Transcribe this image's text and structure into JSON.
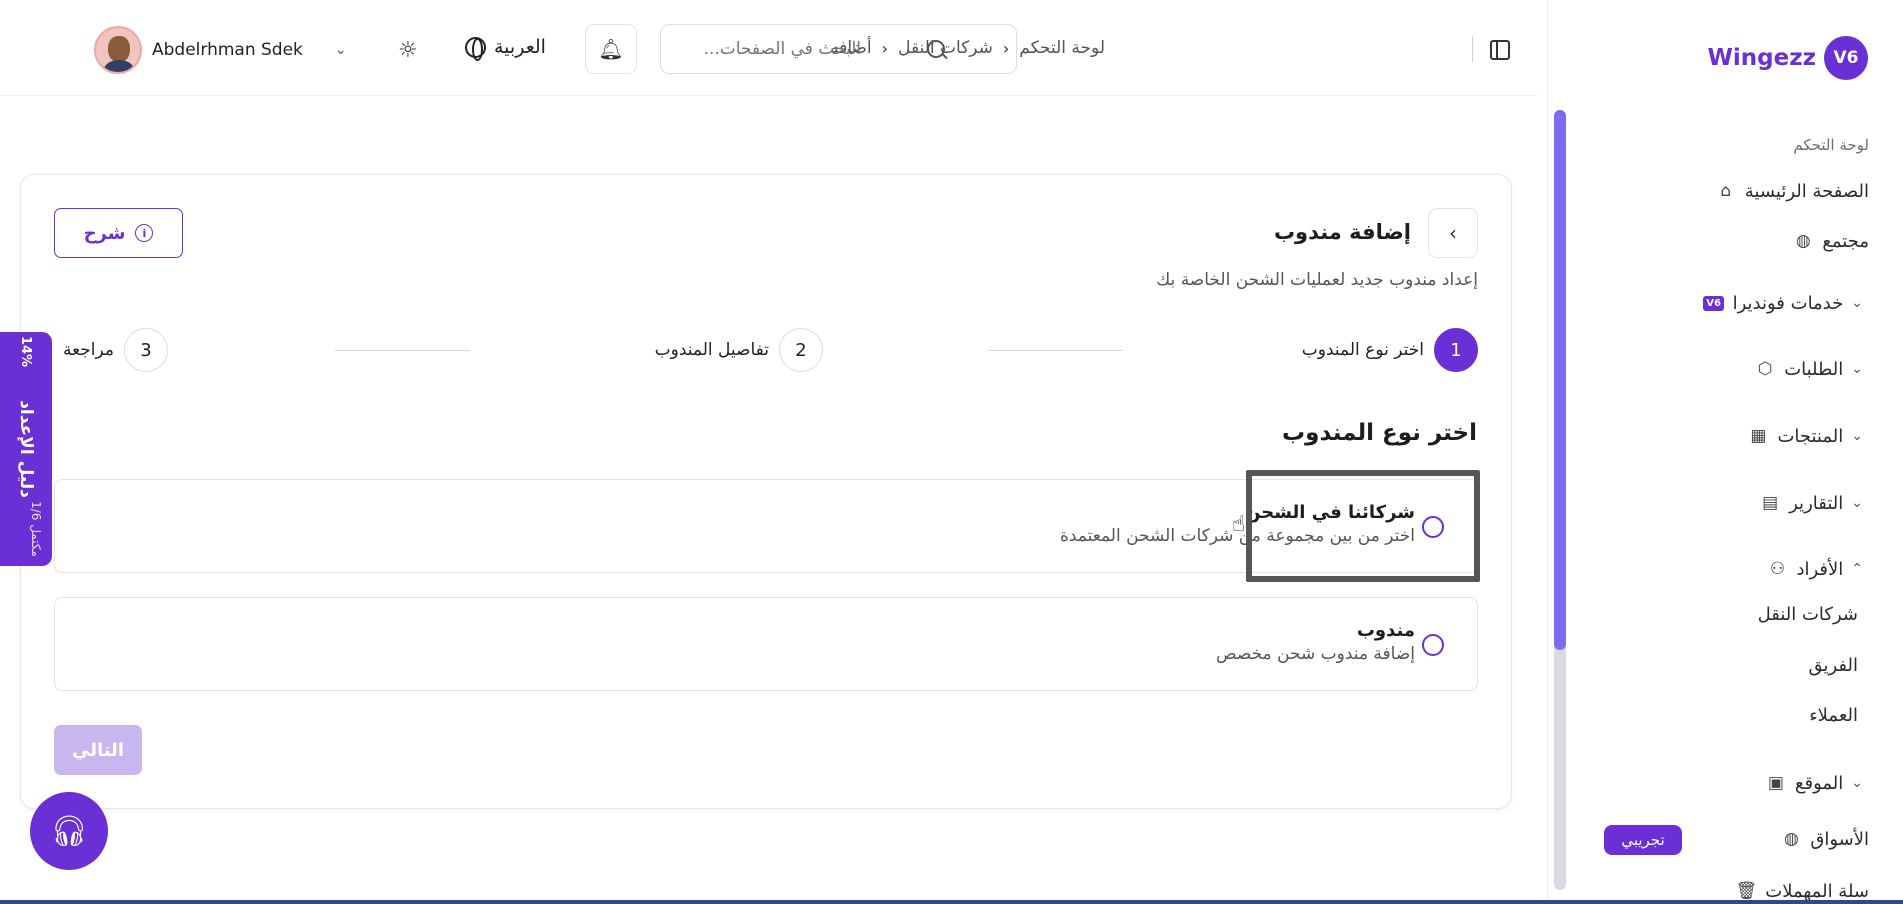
{
  "brand": {
    "name": "Wingezz",
    "logo_text": "V6"
  },
  "header": {
    "breadcrumb": [
      "لوحة التحكم",
      "شركات النقل",
      "أضافه"
    ],
    "search_placeholder": "البحث في الصفحات...",
    "language": "العربية",
    "user_name": "Abdelrhman Sdek"
  },
  "sidebar": {
    "section_label": "لوحة التحكم",
    "items": [
      {
        "label": "الصفحة الرئيسية",
        "icon": "home-icon"
      },
      {
        "label": "مجتمع",
        "icon": "globe-icon"
      },
      {
        "label": "خدمات فونديرا",
        "icon": "vs-icon"
      },
      {
        "label": "الطلبات",
        "icon": "box-icon"
      },
      {
        "label": "المنتجات",
        "icon": "boxes-icon"
      },
      {
        "label": "التقارير",
        "icon": "report-icon"
      },
      {
        "label": "الأفراد",
        "icon": "users-icon"
      },
      {
        "label": "الموقع",
        "icon": "store-icon"
      },
      {
        "label": "الأسواق",
        "icon": "globe-icon"
      },
      {
        "label": "سلة المهملات",
        "icon": "trash-icon"
      }
    ],
    "sub_items": [
      "شركات النقل",
      "الفريق",
      "العملاء"
    ],
    "trial_badge": "تجريبي"
  },
  "page": {
    "title": "إضافة مندوب",
    "subtitle": "إعداد مندوب جديد لعمليات الشحن الخاصة بك",
    "explain_label": "شرح",
    "steps": [
      {
        "number": "1",
        "label": "اختر نوع المندوب"
      },
      {
        "number": "2",
        "label": "تفاصيل المندوب"
      },
      {
        "number": "3",
        "label": "مراجعة"
      }
    ],
    "section_title": "اختر نوع المندوب",
    "options": [
      {
        "title": "شركائنا في الشحن",
        "description": "اختر من بين مجموعة من شركات الشحن المعتمدة"
      },
      {
        "title": "مندوب",
        "description": "إضافة مندوب شحن مخصص"
      }
    ],
    "next_label": "التالي"
  },
  "guide_tab": {
    "label": "دليل الإعداد",
    "progress": "1/6 مكتمل",
    "percent": "14%"
  },
  "colors": {
    "accent": "#6b2fd6",
    "disabled": "#c8b6ef"
  }
}
